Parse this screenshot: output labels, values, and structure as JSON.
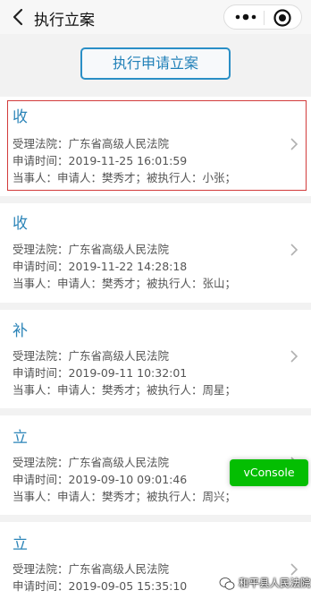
{
  "nav": {
    "title": "执行立案",
    "back_icon": "chevron-left-icon",
    "more_icon": "more-dots-icon",
    "close_icon": "target-circle-icon"
  },
  "apply_button": "执行申请立案",
  "cases": [
    {
      "tag": "收",
      "court": "受理法院：广东省高级人民法院",
      "time": "申请时间：2019-11-25 16:01:59",
      "parties": "当事人：申请人：樊秀才；被执行人：小张；"
    },
    {
      "tag": "收",
      "court": "受理法院：广东省高级人民法院",
      "time": "申请时间：2019-11-22 14:28:18",
      "parties": "当事人：申请人：樊秀才；被执行人：张山；"
    },
    {
      "tag": "补",
      "court": "受理法院：广东省高级人民法院",
      "time": "申请时间：2019-09-11 10:32:01",
      "parties": "当事人：申请人：樊秀才；被执行人：周星；"
    },
    {
      "tag": "立",
      "court": "受理法院：广东省高级人民法院",
      "time": "申请时间：2019-09-10 09:01:46",
      "parties": "当事人：申请人：樊秀才；被执行人：周兴；"
    },
    {
      "tag": "立",
      "court": "受理法院：广东省高级人民法院",
      "time": "申请时间：2019-09-05 15:35:10",
      "parties": ""
    }
  ],
  "vconsole": "vConsole",
  "watermark": "和平县人民法院",
  "colors": {
    "accent": "#2b84b8",
    "highlight": "#d23b3b",
    "vconsole": "#04be02"
  }
}
